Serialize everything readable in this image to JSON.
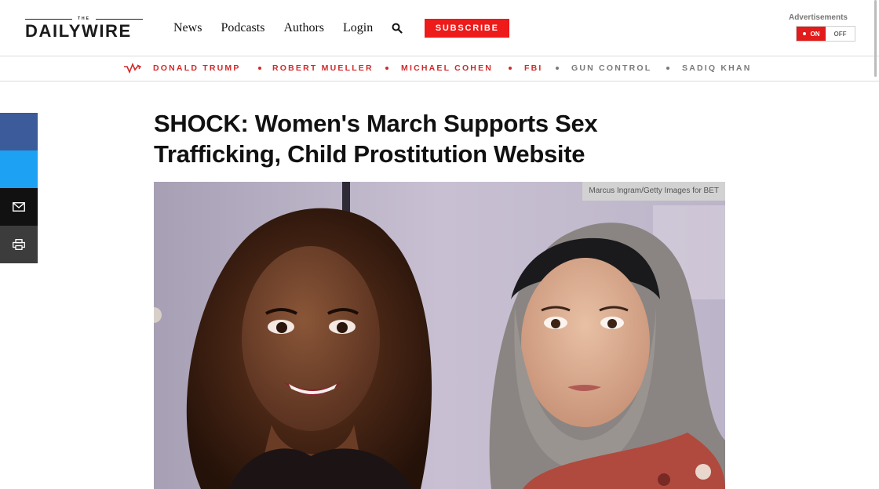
{
  "header": {
    "logo_small": "THE",
    "logo_main": "DAILYWIRE",
    "nav": [
      "News",
      "Podcasts",
      "Authors",
      "Login"
    ],
    "subscribe_label": "SUBSCRIBE",
    "ads_label": "Advertisements",
    "toggle_on": "ON",
    "toggle_off": "OFF"
  },
  "trending": {
    "topics": [
      {
        "label": "DONALD TRUMP",
        "color": "#d12a2a"
      },
      {
        "label": "ROBERT MUELLER",
        "color": "#d12a2a"
      },
      {
        "label": "MICHAEL COHEN",
        "color": "#d12a2a"
      },
      {
        "label": "FBI",
        "color": "#d12a2a"
      },
      {
        "label": "GUN CONTROL",
        "color": "#7a7a7a"
      },
      {
        "label": "SADIQ KHAN",
        "color": "#7a7a7a"
      }
    ]
  },
  "share": {
    "buttons": [
      {
        "icon": "facebook-icon",
        "color": "#3b5b9a"
      },
      {
        "icon": "twitter-icon",
        "color": "#1da1f2"
      },
      {
        "icon": "mail-icon",
        "color": "#111111"
      },
      {
        "icon": "print-icon",
        "color": "#3c3c3c"
      }
    ]
  },
  "article": {
    "headline_line1": "SHOCK: Women's March Supports Sex",
    "headline_line2": "Trafficking, Child Prostitution Website",
    "photo_credit": "Marcus Ingram/Getty Images for BET"
  },
  "colors": {
    "brand_red": "#ee1b1b",
    "toggle_red": "#e21b1b"
  }
}
